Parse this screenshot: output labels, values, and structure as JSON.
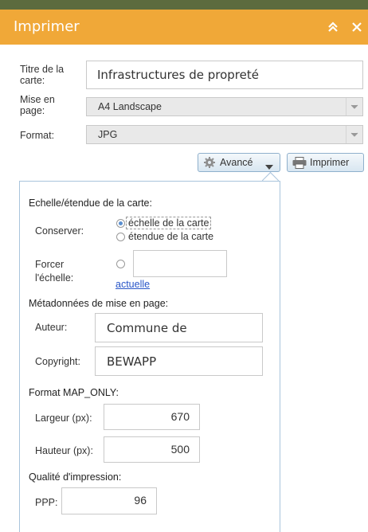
{
  "header": {
    "title": "Imprimer"
  },
  "form": {
    "title_label": "Titre de la carte:",
    "title_value": "Infrastructures de propreté",
    "layout_label": "Mise en page:",
    "layout_value": "A4 Landscape",
    "format_label": "Format:",
    "format_value": "JPG"
  },
  "buttons": {
    "advanced": "Avancé",
    "print": "Imprimer"
  },
  "advanced": {
    "scale_title": "Echelle/étendue de la carte:",
    "keep_label": "Conserver:",
    "keep_options": [
      "échelle de la carte",
      "étendue de la carte"
    ],
    "force_label_1": "Forcer",
    "force_label_2": "l'échelle:",
    "current_link": "actuelle",
    "metadata_title": "Métadonnées de mise en page:",
    "author_label": "Auteur:",
    "author_value": "Commune de",
    "copyright_label": "Copyright:",
    "copyright_value": "BEWAPP",
    "maponly_title": "Format MAP_ONLY:",
    "width_label": "Largeur (px):",
    "width_value": "670",
    "height_label": "Hauteur (px):",
    "height_value": "500",
    "quality_title": "Qualité d'impression:",
    "dpi_label": "PPP:",
    "dpi_value": "96"
  },
  "icons": {
    "collapse": "double-chevron-up-icon",
    "close": "close-icon",
    "gear": "gear-icon",
    "printer": "printer-icon",
    "dropdown": "dropdown-arrow-icon"
  },
  "colors": {
    "header": "#f0a838",
    "link": "#2956c8",
    "panel_border": "#a9c4dc"
  }
}
